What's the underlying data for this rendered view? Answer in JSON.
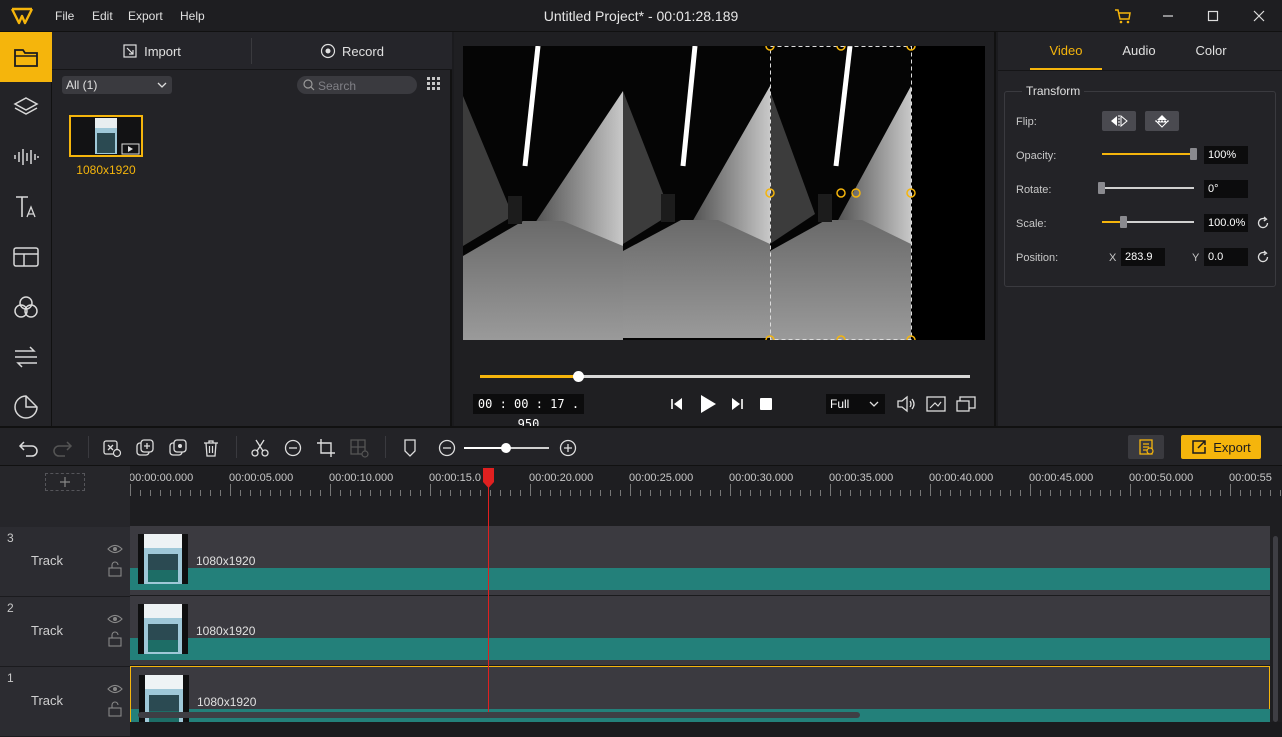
{
  "app": {
    "title": "Untitled Project* - 00:01:28.189",
    "menu": [
      "File",
      "Edit",
      "Export",
      "Help"
    ]
  },
  "colors": {
    "accent": "#f5b50c",
    "clip_bar": "#23807a",
    "playhead": "#e02020"
  },
  "left_toolbar": {
    "items": [
      "folder-icon",
      "layers-icon",
      "audio-waveform-icon",
      "text-icon",
      "template-icon",
      "filters-icon",
      "transitions-icon",
      "stickers-icon"
    ]
  },
  "media": {
    "import_label": "Import",
    "record_label": "Record",
    "filter_value": "All (1)",
    "search_placeholder": "Search",
    "items": [
      {
        "label": "1080x1920"
      }
    ]
  },
  "preview": {
    "timecode": "00 : 00 : 17 . 950",
    "zoom_value": "Full",
    "progress": 0.2
  },
  "properties": {
    "tabs": [
      "Video",
      "Audio",
      "Color"
    ],
    "active_tab": "Video",
    "section_title": "Transform",
    "flip_label": "Flip:",
    "opacity_label": "Opacity:",
    "opacity_value": "100%",
    "rotate_label": "Rotate:",
    "rotate_value": "0°",
    "scale_label": "Scale:",
    "scale_value": "100.0%",
    "position_label": "Position:",
    "position_x_label": "X",
    "position_x_value": "283.9",
    "position_y_label": "Y",
    "position_y_value": "0.0"
  },
  "timeline_toolbar": {
    "export_label": "Export"
  },
  "timeline": {
    "ruler_labels": [
      "00:00:00.000",
      "00:00:05.000",
      "00:00:10.000",
      "00:00:15.0",
      "00:00:20.000",
      "00:00:25.000",
      "00:00:30.000",
      "00:00:35.000",
      "00:00:40.000",
      "00:00:45.000",
      "00:00:50.000",
      "00:00:55"
    ],
    "tracks": [
      {
        "number": "3",
        "name": "Track",
        "clip_label": "1080x1920"
      },
      {
        "number": "2",
        "name": "Track",
        "clip_label": "1080x1920"
      },
      {
        "number": "1",
        "name": "Track",
        "clip_label": "1080x1920"
      }
    ]
  }
}
